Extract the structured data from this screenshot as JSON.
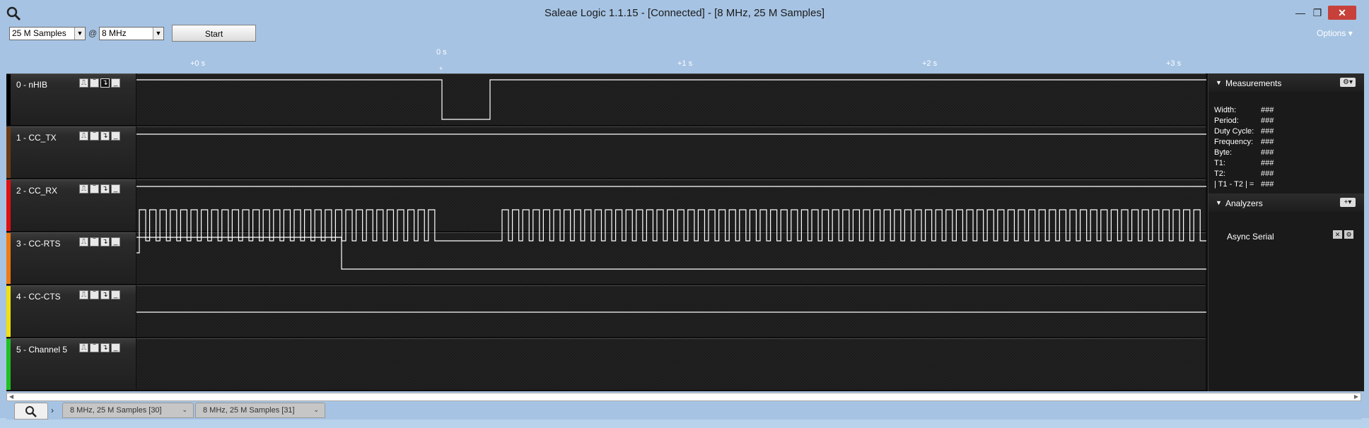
{
  "window": {
    "title": "Saleae Logic 1.1.15 - [Connected] - [8 MHz, 25 M Samples]",
    "controls": [
      "minimize",
      "restore",
      "close"
    ]
  },
  "toolbar": {
    "samples_value": "25 M Samples",
    "at_symbol": "@",
    "rate_value": "8 MHz",
    "start_label": "Start",
    "options_label": "Options ▾"
  },
  "timeline": {
    "zero_label": "0 s",
    "ticks": [
      "+0 s",
      "+1 s",
      "+2 s",
      "+3 s"
    ]
  },
  "channels": [
    {
      "label": "0 - nHIB",
      "color": "#000000"
    },
    {
      "label": "1 - CC_TX",
      "color": "#6b3a12"
    },
    {
      "label": "2 - CC_RX",
      "color": "#e01010"
    },
    {
      "label": "3 - CC-RTS",
      "color": "#f07a10"
    },
    {
      "label": "4 - CC-CTS",
      "color": "#f0e010"
    },
    {
      "label": "5 - Channel 5",
      "color": "#20c020"
    }
  ],
  "measurements": {
    "title": "Measurements",
    "rows": [
      {
        "label": "Width:",
        "value": "###"
      },
      {
        "label": "Period:",
        "value": "###"
      },
      {
        "label": "Duty Cycle:",
        "value": "###"
      },
      {
        "label": "Frequency:",
        "value": "###"
      },
      {
        "label": "Byte:",
        "value": "###"
      },
      {
        "label": "T1:",
        "value": "###"
      },
      {
        "label": "T2:",
        "value": "###"
      },
      {
        "label": "| T1 - T2 | =",
        "value": "###"
      }
    ]
  },
  "analyzers": {
    "title": "Analyzers",
    "items": [
      {
        "label": "Async Serial"
      }
    ]
  },
  "tabs": [
    {
      "label": "8 MHz, 25 M Samples [30]"
    },
    {
      "label": "8 MHz, 25 M Samples [31]"
    }
  ],
  "icons": {
    "app": "magnifier-icon",
    "panel_settings": "gear-icon",
    "add_analyzer": "plus-icon"
  }
}
